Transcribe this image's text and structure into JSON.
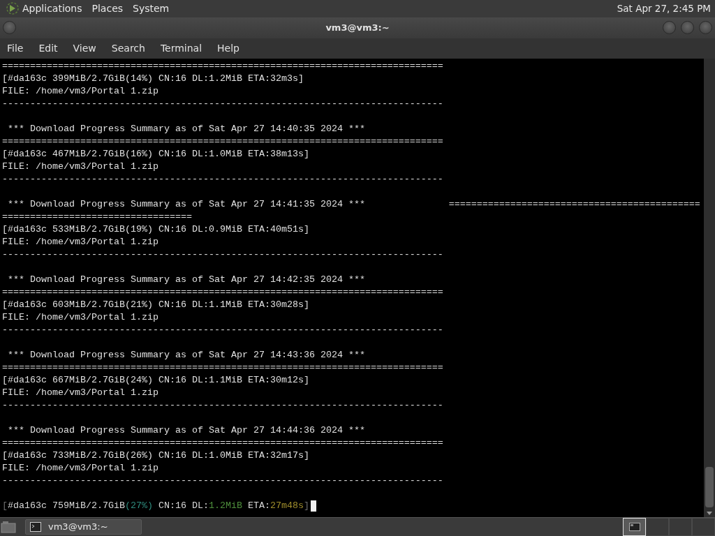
{
  "top_panel": {
    "menus": [
      "Applications",
      "Places",
      "System"
    ],
    "clock": "Sat Apr 27, 2:45 PM"
  },
  "window": {
    "title": "vm3@vm3:~"
  },
  "menu_bar": [
    "File",
    "Edit",
    "View",
    "Search",
    "Terminal",
    "Help"
  ],
  "terminal": {
    "lines": [
      {
        "kind": "text",
        "text": "==============================================================================="
      },
      {
        "kind": "text",
        "text": "[#da163c 399MiB/2.7GiB(14%) CN:16 DL:1.2MiB ETA:32m3s]"
      },
      {
        "kind": "text",
        "text": "FILE: /home/vm3/Portal 1.zip"
      },
      {
        "kind": "text",
        "text": "-------------------------------------------------------------------------------"
      },
      {
        "kind": "blank"
      },
      {
        "kind": "text",
        "text": " *** Download Progress Summary as of Sat Apr 27 14:40:35 2024 ***"
      },
      {
        "kind": "text",
        "text": "==============================================================================="
      },
      {
        "kind": "text",
        "text": "[#da163c 467MiB/2.7GiB(16%) CN:16 DL:1.0MiB ETA:38m13s]"
      },
      {
        "kind": "text",
        "text": "FILE: /home/vm3/Portal 1.zip"
      },
      {
        "kind": "text",
        "text": "-------------------------------------------------------------------------------"
      },
      {
        "kind": "blank"
      },
      {
        "kind": "text",
        "text": " *** Download Progress Summary as of Sat Apr 27 14:41:35 2024 ***               ============================================="
      },
      {
        "kind": "text",
        "text": "=================================="
      },
      {
        "kind": "text",
        "text": "[#da163c 533MiB/2.7GiB(19%) CN:16 DL:0.9MiB ETA:40m51s]"
      },
      {
        "kind": "text",
        "text": "FILE: /home/vm3/Portal 1.zip"
      },
      {
        "kind": "text",
        "text": "-------------------------------------------------------------------------------"
      },
      {
        "kind": "blank"
      },
      {
        "kind": "text",
        "text": " *** Download Progress Summary as of Sat Apr 27 14:42:35 2024 ***"
      },
      {
        "kind": "text",
        "text": "==============================================================================="
      },
      {
        "kind": "text",
        "text": "[#da163c 603MiB/2.7GiB(21%) CN:16 DL:1.1MiB ETA:30m28s]"
      },
      {
        "kind": "text",
        "text": "FILE: /home/vm3/Portal 1.zip"
      },
      {
        "kind": "text",
        "text": "-------------------------------------------------------------------------------"
      },
      {
        "kind": "blank"
      },
      {
        "kind": "text",
        "text": " *** Download Progress Summary as of Sat Apr 27 14:43:36 2024 ***"
      },
      {
        "kind": "text",
        "text": "==============================================================================="
      },
      {
        "kind": "text",
        "text": "[#da163c 667MiB/2.7GiB(24%) CN:16 DL:1.1MiB ETA:30m12s]"
      },
      {
        "kind": "text",
        "text": "FILE: /home/vm3/Portal 1.zip"
      },
      {
        "kind": "text",
        "text": "-------------------------------------------------------------------------------"
      },
      {
        "kind": "blank"
      },
      {
        "kind": "text",
        "text": " *** Download Progress Summary as of Sat Apr 27 14:44:36 2024 ***"
      },
      {
        "kind": "text",
        "text": "==============================================================================="
      },
      {
        "kind": "text",
        "text": "[#da163c 733MiB/2.7GiB(26%) CN:16 DL:1.0MiB ETA:32m17s]"
      },
      {
        "kind": "text",
        "text": "FILE: /home/vm3/Portal 1.zip"
      },
      {
        "kind": "text",
        "text": "-------------------------------------------------------------------------------"
      },
      {
        "kind": "blank"
      },
      {
        "kind": "segments",
        "cursor": true,
        "segments": [
          {
            "text": "[",
            "color": "#6e6e6e"
          },
          {
            "text": "#da163c 759MiB/2.7GiB",
            "color": "#d8d8d8"
          },
          {
            "text": "(27%)",
            "color": "#2e8b7d"
          },
          {
            "text": " CN:16 DL:",
            "color": "#d8d8d8"
          },
          {
            "text": "1.2MiB",
            "color": "#4e8f3c"
          },
          {
            "text": " ETA:",
            "color": "#d8d8d8"
          },
          {
            "text": "27m48s",
            "color": "#a08e2c"
          },
          {
            "text": "]",
            "color": "#6e6e6e"
          }
        ]
      }
    ]
  },
  "taskbar": {
    "tasks": [
      {
        "label": "vm3@vm3:~",
        "selected": false
      }
    ],
    "workspaces": [
      {
        "selected": true
      },
      {
        "selected": false
      },
      {
        "selected": false
      },
      {
        "selected": false
      }
    ]
  }
}
